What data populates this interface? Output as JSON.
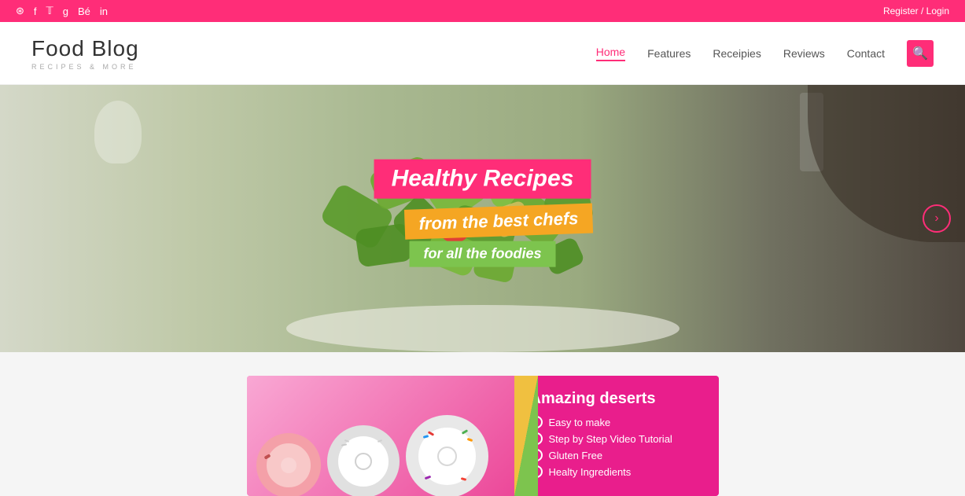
{
  "topbar": {
    "register_login": "Register / Login",
    "icons": [
      "pinterest",
      "facebook",
      "twitter",
      "google",
      "behance",
      "linkedin"
    ]
  },
  "header": {
    "logo_title": "Food Blog",
    "logo_subtitle": "Recipes & More",
    "nav_items": [
      {
        "label": "Home",
        "active": true
      },
      {
        "label": "Features",
        "active": false
      },
      {
        "label": "Receipies",
        "active": false
      },
      {
        "label": "Reviews",
        "active": false
      },
      {
        "label": "Contact",
        "active": false
      }
    ]
  },
  "hero": {
    "tag1": "Healthy Recipes",
    "tag2": "from the best chefs",
    "tag3": "for all the foodies"
  },
  "dessert": {
    "title": "Amazing deserts",
    "features": [
      "Easy to make",
      "Step by Step Video Tutorial",
      "Gluten Free",
      "Healty Ingredients"
    ]
  },
  "colors": {
    "pink": "#ff2d78",
    "orange": "#f5a623",
    "green": "#7dc44e",
    "dark_pink": "#e91e8c"
  }
}
